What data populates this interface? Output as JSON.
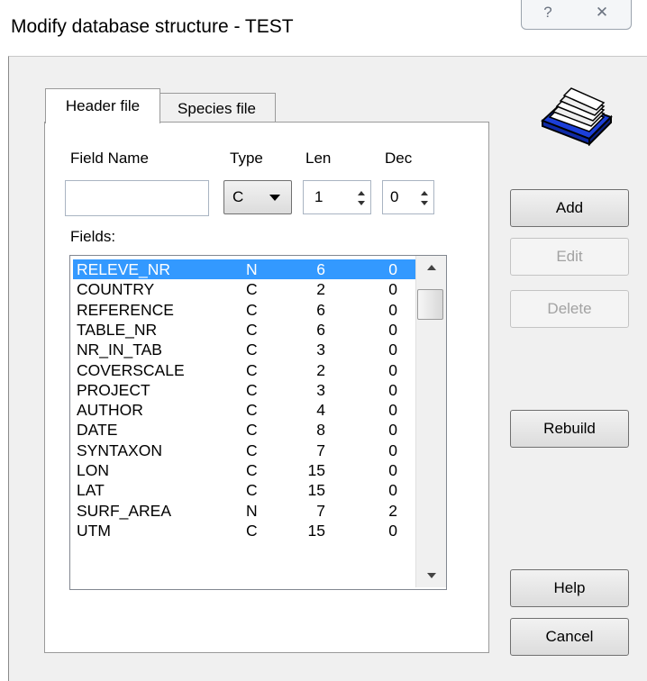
{
  "window": {
    "title": "Modify database structure - TEST",
    "help_glyph": "?",
    "close_glyph": "✕"
  },
  "tabs": [
    {
      "label": "Header file",
      "active": true
    },
    {
      "label": "Species file",
      "active": false
    }
  ],
  "form": {
    "field_name_label": "Field Name",
    "type_label": "Type",
    "len_label": "Len",
    "dec_label": "Dec",
    "field_name_value": "",
    "type_value": "C",
    "len_value": "1",
    "dec_value": "0",
    "fields_label": "Fields:"
  },
  "fields": [
    {
      "name": "RELEVE_NR",
      "type": "N",
      "len": "6",
      "dec": "0",
      "selected": true
    },
    {
      "name": "COUNTRY",
      "type": "C",
      "len": "2",
      "dec": "0"
    },
    {
      "name": "REFERENCE",
      "type": "C",
      "len": "6",
      "dec": "0"
    },
    {
      "name": "TABLE_NR",
      "type": "C",
      "len": "6",
      "dec": "0"
    },
    {
      "name": "NR_IN_TAB",
      "type": "C",
      "len": "3",
      "dec": "0"
    },
    {
      "name": "COVERSCALE",
      "type": "C",
      "len": "2",
      "dec": "0"
    },
    {
      "name": "PROJECT",
      "type": "C",
      "len": "3",
      "dec": "0"
    },
    {
      "name": "AUTHOR",
      "type": "C",
      "len": "4",
      "dec": "0"
    },
    {
      "name": "DATE",
      "type": "C",
      "len": "8",
      "dec": "0"
    },
    {
      "name": "SYNTAXON",
      "type": "C",
      "len": "7",
      "dec": "0"
    },
    {
      "name": "LON",
      "type": "C",
      "len": "15",
      "dec": "0"
    },
    {
      "name": "LAT",
      "type": "C",
      "len": "15",
      "dec": "0"
    },
    {
      "name": "SURF_AREA",
      "type": "N",
      "len": "7",
      "dec": "2"
    },
    {
      "name": "UTM",
      "type": "C",
      "len": "15",
      "dec": "0"
    }
  ],
  "buttons": {
    "add": "Add",
    "edit": "Edit",
    "delete": "Delete",
    "rebuild": "Rebuild",
    "help": "Help",
    "cancel": "Cancel"
  },
  "icons": {
    "database": "card-file-box-icon"
  },
  "colors": {
    "selection": "#3399ff",
    "dialog_bg": "#f0f0f0",
    "icon_blue": "#1c3fd8"
  }
}
